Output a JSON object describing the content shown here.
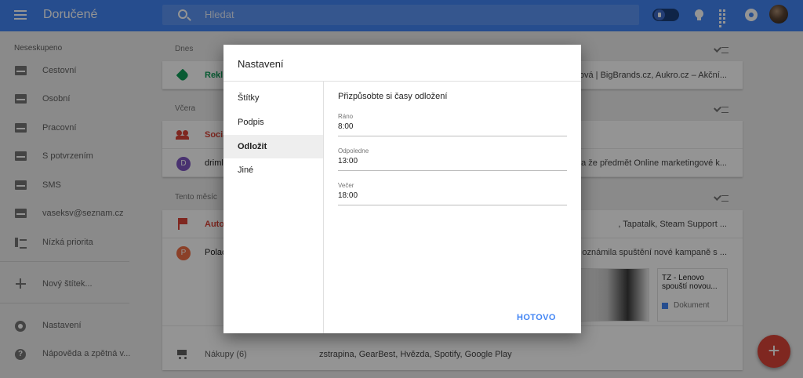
{
  "app": {
    "title": "Doručené"
  },
  "search": {
    "placeholder": "Hledat"
  },
  "sidebar": {
    "heading": "Neseskupeno",
    "items": [
      {
        "label": "Cestovní",
        "icon": "envelope-icon"
      },
      {
        "label": "Osobní",
        "icon": "envelope-icon"
      },
      {
        "label": "Pracovní",
        "icon": "envelope-icon"
      },
      {
        "label": "S potvrzením",
        "icon": "envelope-icon"
      },
      {
        "label": "SMS",
        "icon": "envelope-icon"
      },
      {
        "label": "vaseksv@seznam.cz",
        "icon": "envelope-icon"
      },
      {
        "label": "Nízká priorita",
        "icon": "low-priority-icon"
      }
    ],
    "new_label": "Nový štítek...",
    "settings": "Nastavení",
    "help": "Nápověda a zpětná v..."
  },
  "inbox": {
    "sections": {
      "today": "Dnes",
      "yesterday": "Včera",
      "this_month": "Tento měsíc"
    },
    "rows": [
      {
        "sender": "Rekl",
        "snippet": "ová | BigBrands.cz, Aukro.cz – Akční..."
      },
      {
        "sender": "Socia",
        "snippet": ""
      },
      {
        "avatar_letter": "D",
        "sender": "drimlo",
        "snippet": "vala že předmět Online marketingové k..."
      },
      {
        "sender": "Auto",
        "snippet": ", Tapatalk, Steam Support ..."
      },
      {
        "avatar_letter": "P",
        "sender": "Polac",
        "snippet": "ovo oznámila spuštění nové kampaně s ..."
      },
      {
        "sender": "Nákupy (6)",
        "snippet": "zstrapina, GearBest, Hvězda, Spotify, Google Play"
      }
    ],
    "attachment": {
      "title_line1": "TZ - Lenovo",
      "title_line2": "spouští novou...",
      "type": "Dokument"
    }
  },
  "dialog": {
    "title": "Nastavení",
    "nav": [
      "Štítky",
      "Podpis",
      "Odložit",
      "Jiné"
    ],
    "active_nav": "Odložit",
    "content_title": "Přizpůsobte si časy odložení",
    "fields": [
      {
        "label": "Ráno",
        "value": "8:00"
      },
      {
        "label": "Odpoledne",
        "value": "13:00"
      },
      {
        "label": "Večer",
        "value": "18:00"
      }
    ],
    "done": "HOTOVO"
  },
  "colors": {
    "primary": "#4285f4",
    "fab": "#db4437",
    "bundle_green": "#0f9d58",
    "social_red": "#db4437"
  }
}
